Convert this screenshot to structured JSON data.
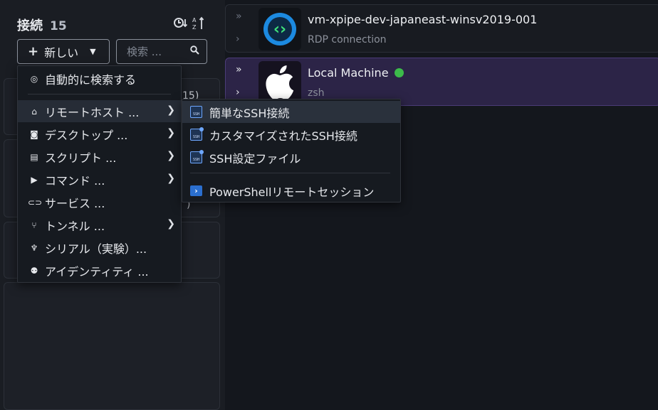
{
  "header": {
    "title": "接続",
    "count": "15",
    "sort_icons": [
      "sort-time-icon",
      "sort-alpha-icon"
    ]
  },
  "new_button": {
    "label": "新しい",
    "icon": "plus-icon"
  },
  "search": {
    "placeholder": "検索 ..."
  },
  "background_partial": {
    "count_fragment": "15)",
    "paren_fragment": ")"
  },
  "menu": {
    "items": [
      {
        "label": "自動的に検索する",
        "icon": "auto-search-icon",
        "has_submenu": false
      },
      {
        "label": "リモートホスト ...",
        "icon": "home-icon",
        "has_submenu": true,
        "active": true
      },
      {
        "label": "デスクトップ ...",
        "icon": "camera-icon",
        "has_submenu": true
      },
      {
        "label": "スクリプト ...",
        "icon": "script-icon",
        "has_submenu": true
      },
      {
        "label": "コマンド ...",
        "icon": "terminal-icon",
        "has_submenu": true
      },
      {
        "label": "サービス ...",
        "icon": "link-icon",
        "has_submenu": false
      },
      {
        "label": "トンネル ...",
        "icon": "tunnel-icon",
        "has_submenu": true
      },
      {
        "label": "シリアル（実験）...",
        "icon": "serial-icon",
        "has_submenu": false
      },
      {
        "label": "アイデンティティ ...",
        "icon": "identity-icon",
        "has_submenu": false
      }
    ]
  },
  "submenu": {
    "items": [
      {
        "label": "簡単なSSH接続",
        "icon": "ssh-icon",
        "active": true
      },
      {
        "label": "カスタマイズされたSSH接続",
        "icon": "ssh-icon"
      },
      {
        "label": "SSH設定ファイル",
        "icon": "ssh-icon"
      },
      {
        "label": "PowerShellリモートセッション",
        "icon": "powershell-icon"
      }
    ]
  },
  "connections": [
    {
      "name": "vm-xpipe-dev-japaneast-winsv2019-001",
      "subtitle": "RDP connection",
      "icon": "rdp-icon",
      "status": ""
    },
    {
      "name": "Local Machine",
      "subtitle": "zsh",
      "icon": "apple-icon",
      "status": "online",
      "status_color": "#3cbb4a",
      "selected": true
    }
  ],
  "colors": {
    "accent": "#2c2447",
    "selected_border": "#4b3c78",
    "ssh_icon": "#6ea7ff",
    "online": "#3cbb4a"
  }
}
